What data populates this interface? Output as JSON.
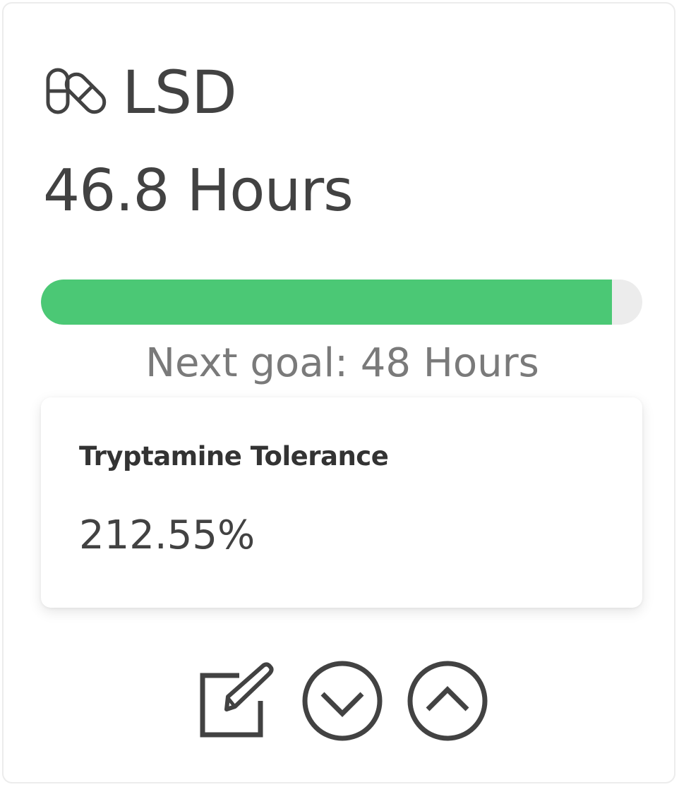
{
  "drug": {
    "name": "LSD",
    "icon": "pill-icon"
  },
  "elapsed": {
    "text": "46.8 Hours"
  },
  "progress": {
    "fraction": 0.95,
    "color": "#4bc875",
    "track_color": "#ececec"
  },
  "next_goal": {
    "text": "Next goal: 48 Hours"
  },
  "tolerance": {
    "title": "Tryptamine Tolerance",
    "value": "212.55%"
  },
  "actions": [
    {
      "name": "edit",
      "icon": "edit-icon"
    },
    {
      "name": "collapse",
      "icon": "chevron-down-circle-icon"
    },
    {
      "name": "expand",
      "icon": "chevron-up-circle-icon"
    }
  ]
}
